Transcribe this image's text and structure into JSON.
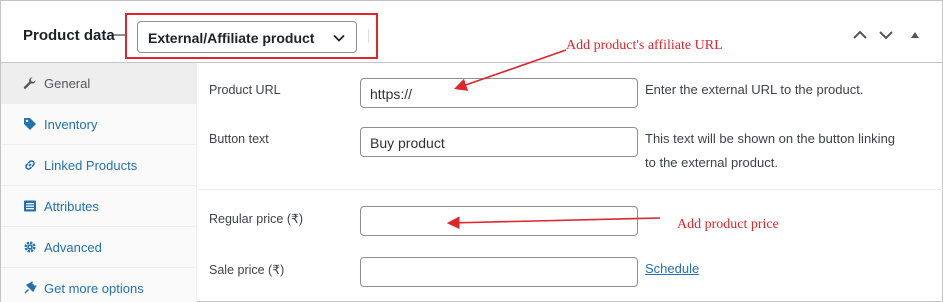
{
  "header": {
    "title": "Product data",
    "separator": "—",
    "product_type": "External/Affiliate product"
  },
  "sidebar": {
    "items": [
      {
        "label": "General",
        "icon": "wrench-icon"
      },
      {
        "label": "Inventory",
        "icon": "tag-icon"
      },
      {
        "label": "Linked Products",
        "icon": "link-icon"
      },
      {
        "label": "Attributes",
        "icon": "list-icon"
      },
      {
        "label": "Advanced",
        "icon": "gear-icon"
      },
      {
        "label": "Get more options",
        "icon": "plugin-icon"
      }
    ]
  },
  "fields": {
    "product_url": {
      "label": "Product URL",
      "value": "https://",
      "desc": "Enter the external URL to the product."
    },
    "button_text": {
      "label": "Button text",
      "value": "Buy product",
      "desc_line1": "This text will be shown on the button linking",
      "desc_line2": "to the external product."
    },
    "regular_price": {
      "label": "Regular price (₹)",
      "value": ""
    },
    "sale_price": {
      "label": "Sale price (₹)",
      "value": "",
      "link": "Schedule"
    }
  },
  "annotations": {
    "url_note": "Add product's affiliate URL",
    "price_note": "Add product price"
  },
  "colors": {
    "accent": "#2271b1",
    "annotation": "#e0262b",
    "border": "#c3c4c7"
  }
}
